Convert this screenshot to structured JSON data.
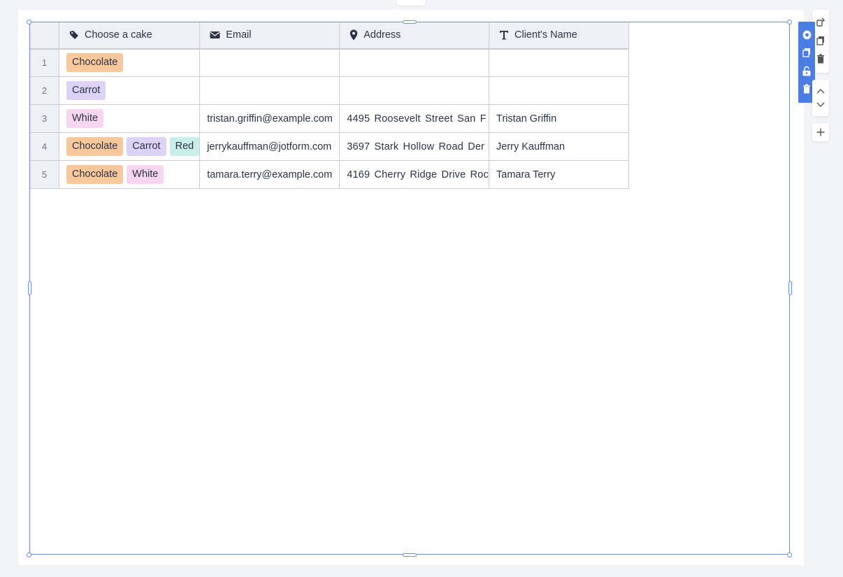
{
  "table": {
    "columns": [
      {
        "label": "Choose a cake",
        "icon": "tag-icon"
      },
      {
        "label": "Email",
        "icon": "envelope-icon"
      },
      {
        "label": "Address",
        "icon": "map-pin-icon"
      },
      {
        "label": "Client's Name",
        "icon": "text-type-icon"
      }
    ],
    "rows": [
      {
        "num": "1",
        "cakes": [
          {
            "label": "Chocolate",
            "color": "#f7c89b"
          }
        ],
        "email": "",
        "address": "",
        "name": ""
      },
      {
        "num": "2",
        "cakes": [
          {
            "label": "Carrot",
            "color": "#dcd3f7"
          }
        ],
        "email": "",
        "address": "",
        "name": ""
      },
      {
        "num": "3",
        "cakes": [
          {
            "label": "White",
            "color": "#f7d6ef"
          }
        ],
        "email": "tristan.griffin@example.com",
        "address": "4495 Roosevelt Street  San F",
        "name": "Tristan Griffin"
      },
      {
        "num": "4",
        "cakes": [
          {
            "label": "Chocolate",
            "color": "#f7c89b"
          },
          {
            "label": "Carrot",
            "color": "#dcd3f7"
          },
          {
            "label": "Red",
            "color": "#c9efe8"
          }
        ],
        "email": "jerrykauffman@jotform.com",
        "address": "3697 Stark Hollow Road  Der",
        "name": "Jerry Kauffman"
      },
      {
        "num": "5",
        "cakes": [
          {
            "label": "Chocolate",
            "color": "#f7c89b"
          },
          {
            "label": "White",
            "color": "#f7d6ef"
          }
        ],
        "email": "tamara.terry@example.com",
        "address": "4169 Cherry Ridge Drive  Roc",
        "name": "Tamara Terry"
      }
    ]
  },
  "colors": {
    "accent": "#4a7ee0",
    "selection": "#6d8fe0",
    "header_bg": "#eef0f5",
    "grid_border": "#c9ccd6"
  },
  "toolbar": {
    "icons": [
      "gear-icon",
      "duplicate-icon",
      "lock-icon",
      "trash-icon"
    ]
  },
  "side_panel": {
    "icons": [
      "paint-brush-icon",
      "copy-icon",
      "delete-icon",
      "chevron-up-icon",
      "chevron-down-icon",
      "plus-icon"
    ]
  }
}
